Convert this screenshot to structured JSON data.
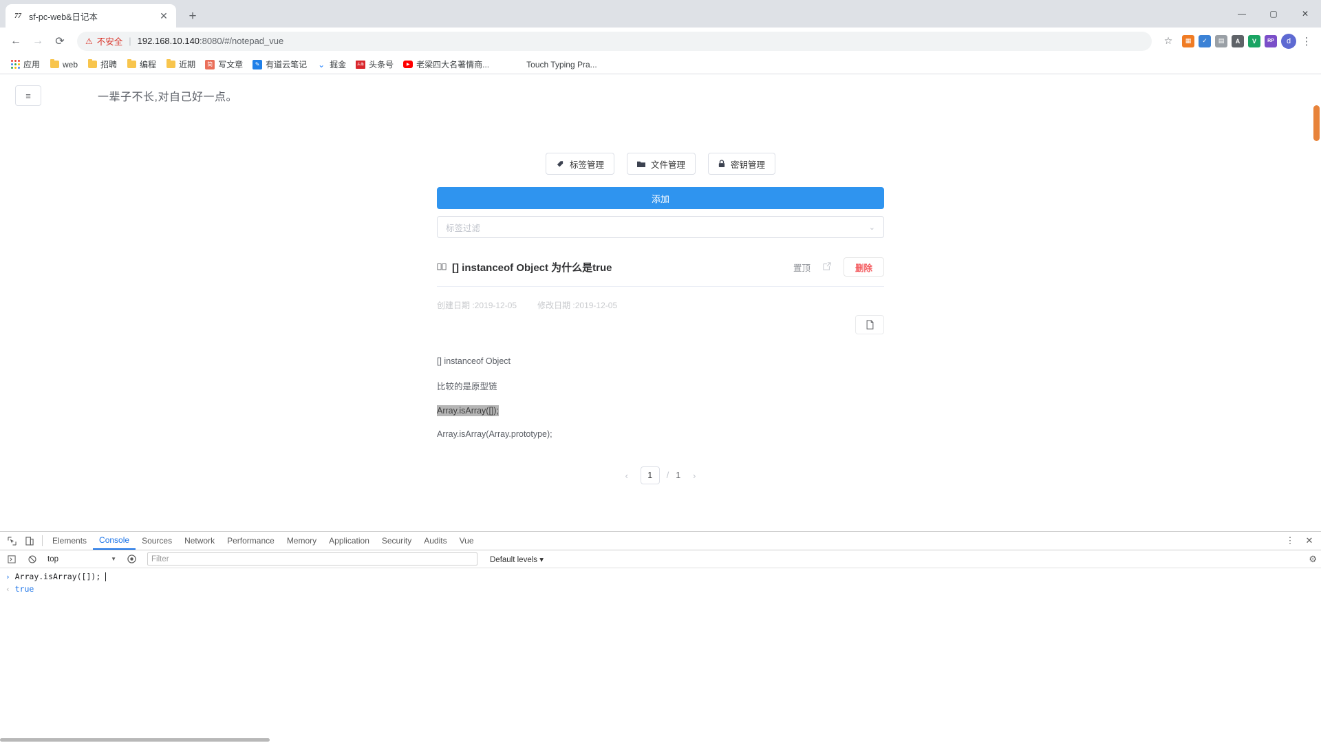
{
  "browser": {
    "tab": {
      "favicon": "77",
      "title": "sf-pc-web&日记本",
      "close_icon": "close-icon"
    },
    "new_tab_label": "+",
    "window_controls": {
      "minimize": "—",
      "maximize": "▢",
      "close": "✕"
    },
    "nav": {
      "back": "←",
      "forward": "→",
      "reload": "⟳"
    },
    "omnibox": {
      "warning_icon": "⚠",
      "warning_text": "不安全",
      "separator": "|",
      "url_host": "192.168.10.140",
      "url_rest": ":8080/#/notepad_vue",
      "star_icon": "☆"
    },
    "extensions": [
      {
        "name": "ext-orange",
        "glyph": "▦",
        "color": "#f07c24"
      },
      {
        "name": "ext-blue",
        "glyph": "✓",
        "color": "#3b82d6"
      },
      {
        "name": "ext-grey",
        "glyph": "▤",
        "color": "#9aa0a6"
      },
      {
        "name": "ext-translate",
        "glyph": "A",
        "color": "#5f6368"
      },
      {
        "name": "ext-green",
        "glyph": "V",
        "color": "#1aa463"
      },
      {
        "name": "ext-purple",
        "glyph": "RP",
        "color": "#7b4fc9"
      }
    ],
    "profile_initial": "d",
    "menu_icon": "⋮",
    "bookmarks": [
      {
        "icon": "apps-grid-icon",
        "label": "应用"
      },
      {
        "icon": "folder-icon",
        "label": "web"
      },
      {
        "icon": "folder-icon",
        "label": "招聘"
      },
      {
        "icon": "folder-icon",
        "label": "编程"
      },
      {
        "icon": "folder-icon",
        "label": "近期"
      },
      {
        "icon": "jianshu-icon",
        "label": "写文章",
        "color": "#ea6f5a",
        "glyph": "简"
      },
      {
        "icon": "youdao-icon",
        "label": "有道云笔记",
        "color": "#1f7fe8",
        "glyph": "✎"
      },
      {
        "icon": "juejin-icon",
        "label": "掘金",
        "color": "#1e80ff",
        "glyph": "◈"
      },
      {
        "icon": "toutiao-icon",
        "label": "头条号",
        "color": "#d9262c",
        "glyph": "头条"
      },
      {
        "icon": "youtube-icon",
        "label": "老梁四大名著情商...",
        "color": "#ff0000",
        "glyph": "▶"
      },
      {
        "icon": "none",
        "label": "Touch Typing Pra..."
      }
    ]
  },
  "app": {
    "menu_toggle_icon": "≡",
    "motto": "一辈子不长,对自己好一点。",
    "management_buttons": [
      {
        "icon": "tag-icon",
        "glyph": "🏷",
        "label": "标签管理"
      },
      {
        "icon": "folder-icon",
        "glyph": "📁",
        "label": "文件管理"
      },
      {
        "icon": "lock-icon",
        "glyph": "🔒",
        "label": "密钥管理"
      }
    ],
    "add_button": {
      "label": "添加",
      "color": "#2f94ef"
    },
    "tag_filter": {
      "placeholder": "标签过滤",
      "value": "",
      "chevron_icon": "chevron-down-icon"
    },
    "note": {
      "book_icon": "book-icon",
      "title": "[] instanceof Object 为什么是true",
      "pin_label": "置顶",
      "external_link_icon": "external-link-icon",
      "delete_label": "删除",
      "delete_color": "#f35c60",
      "created_label": "创建日期 :2019-12-05",
      "modified_label": "修改日期 :2019-12-05",
      "copy_icon": "copy-icon",
      "body_lines": [
        {
          "text": "[] instanceof Object",
          "selected": false
        },
        {
          "text": "比较的是原型链",
          "selected": false
        },
        {
          "text": "Array.isArray([]);",
          "selected": true
        },
        {
          "text": "Array.isArray(Array.prototype);",
          "selected": false
        }
      ]
    },
    "pagination": {
      "prev_icon": "‹",
      "current_page": "1",
      "separator": "/",
      "total_pages": "1",
      "next_icon": "›"
    },
    "scrollbar_thumb_color": "#e8833a"
  },
  "devtools": {
    "inspect_icon": "⬉",
    "device_icon": "▯",
    "tabs": [
      {
        "label": "Elements",
        "active": false
      },
      {
        "label": "Console",
        "active": true
      },
      {
        "label": "Sources",
        "active": false
      },
      {
        "label": "Network",
        "active": false
      },
      {
        "label": "Performance",
        "active": false
      },
      {
        "label": "Memory",
        "active": false
      },
      {
        "label": "Application",
        "active": false
      },
      {
        "label": "Security",
        "active": false
      },
      {
        "label": "Audits",
        "active": false
      },
      {
        "label": "Vue",
        "active": false
      }
    ],
    "more_icon": "⋮",
    "close_icon": "✕",
    "console_toolbar": {
      "sidebar_icon": "▶|",
      "clear_icon": "🚫",
      "context_value": "top",
      "context_chevron": "▼",
      "eye_icon": "◉",
      "filter_placeholder": "Filter",
      "levels_label": "Default levels ▾",
      "settings_icon": "⚙"
    },
    "console_lines": [
      {
        "kind": "input",
        "arrow": "›",
        "text": "Array.isArray([]);"
      },
      {
        "kind": "output",
        "arrow": "‹",
        "text": "true"
      }
    ]
  }
}
